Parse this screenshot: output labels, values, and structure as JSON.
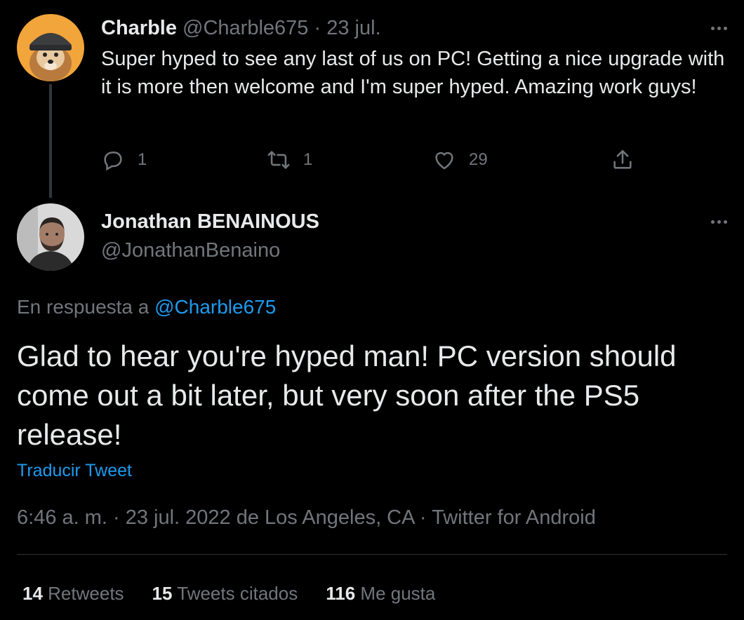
{
  "tweet1": {
    "name": "Charble",
    "handle": "@Charble675",
    "separator": "·",
    "date": "23 jul.",
    "text": "Super hyped to see any last of us on PC! Getting a nice upgrade with it is more then welcome and I'm super hyped. Amazing work guys!",
    "actions": {
      "reply_count": "1",
      "retweet_count": "1",
      "like_count": "29"
    },
    "avatar_icon": "dog-with-beanie-avatar",
    "avatar_bg": "#f2a53a"
  },
  "tweet2": {
    "name": "Jonathan BENAINOUS",
    "handle": "@JonathanBenaino",
    "reply_prefix": "En respuesta a",
    "reply_handle": "@Charble675",
    "text": "Glad to hear you're hyped man! PC version should come out a bit later, but very soon after the PS5 release!",
    "translate_label": "Traducir Tweet",
    "meta": "6:46 a. m. · 23 jul. 2022 de Los Angeles, CA · Twitter for Android",
    "avatar_icon": "bearded-man-avatar",
    "stats": [
      {
        "count": "14",
        "label": "Retweets"
      },
      {
        "count": "15",
        "label": "Tweets citados"
      },
      {
        "count": "116",
        "label": "Me gusta"
      }
    ]
  },
  "colors": {
    "background": "#000000",
    "text": "#e7e9ea",
    "muted": "#71767b",
    "link": "#1d9bf0",
    "divider": "#2f3336"
  }
}
